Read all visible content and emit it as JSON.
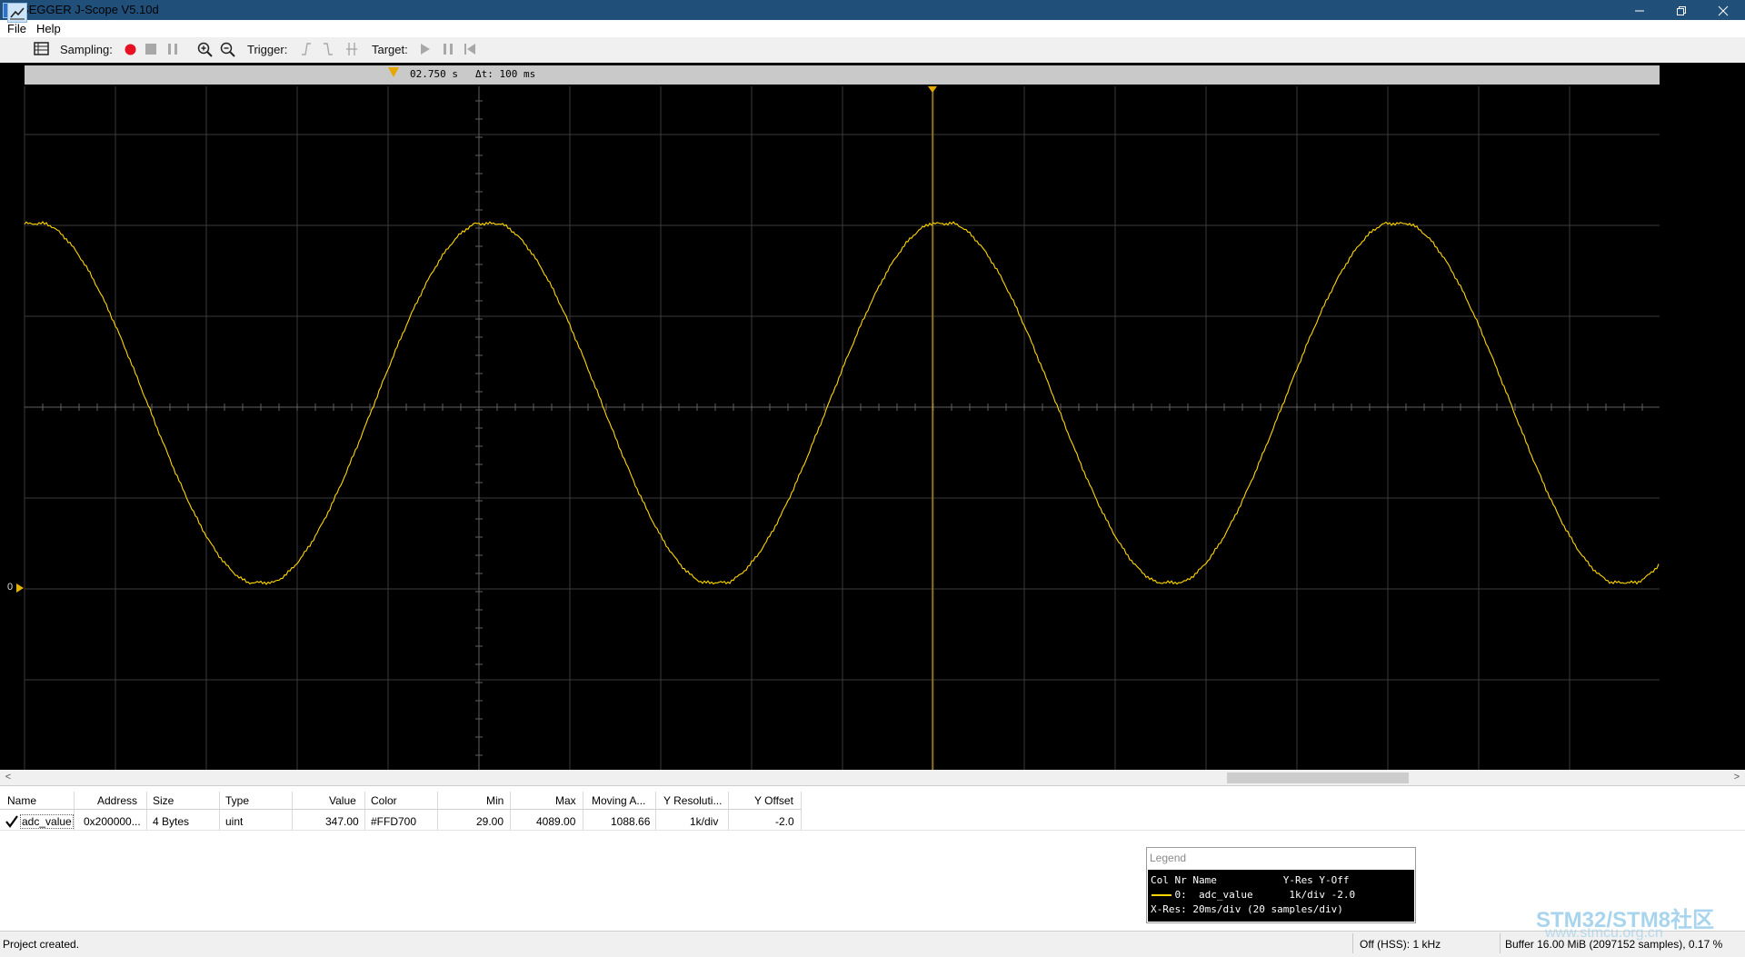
{
  "window": {
    "title": "SEGGER J-Scope V5.10d",
    "icon_text": "J",
    "min_icon": "minimize-icon",
    "max_icon": "restore-icon",
    "close_icon": "close-icon"
  },
  "menu": {
    "file": "File",
    "help": "Help"
  },
  "toolbar": {
    "sampling_label": "Sampling:",
    "trigger_label": "Trigger:",
    "target_label": "Target:",
    "record_color": "#e81123"
  },
  "scope": {
    "cursor_time": "02.750 s",
    "delta": "Δt: 100 ms",
    "zero_label": "0",
    "trace_color": "#FFD700",
    "background": "#000000"
  },
  "table": {
    "headers": [
      "Name",
      "Address",
      "Size",
      "Type",
      "Value",
      "Color",
      "Min",
      "Max",
      "Moving A...",
      "Y Resoluti...",
      "Y Offset"
    ],
    "row": {
      "name": "adc_value",
      "address": "0x200000...",
      "size": "4 Bytes",
      "type": "uint",
      "value": "347.00",
      "color": "#FFD700",
      "min": "29.00",
      "max": "4089.00",
      "moving_avg": "1088.66",
      "y_res": "1k/div",
      "y_offset": "-2.0"
    }
  },
  "legend": {
    "title": "Legend",
    "header": "Col Nr Name           Y-Res Y-Off",
    "entry": "    0:  adc_value      1k/div -2.0",
    "xres": "X-Res: 20ms/div (20 samples/div)"
  },
  "status": {
    "message": "Project created.",
    "speed": "Off (HSS): 1 kHz",
    "buffer": "Buffer 16.00 MiB (2097152 samples), 0.17 %"
  },
  "watermark": {
    "line1": "STM32/STM8社区",
    "line2": "www.stmcu.org.cn"
  }
}
